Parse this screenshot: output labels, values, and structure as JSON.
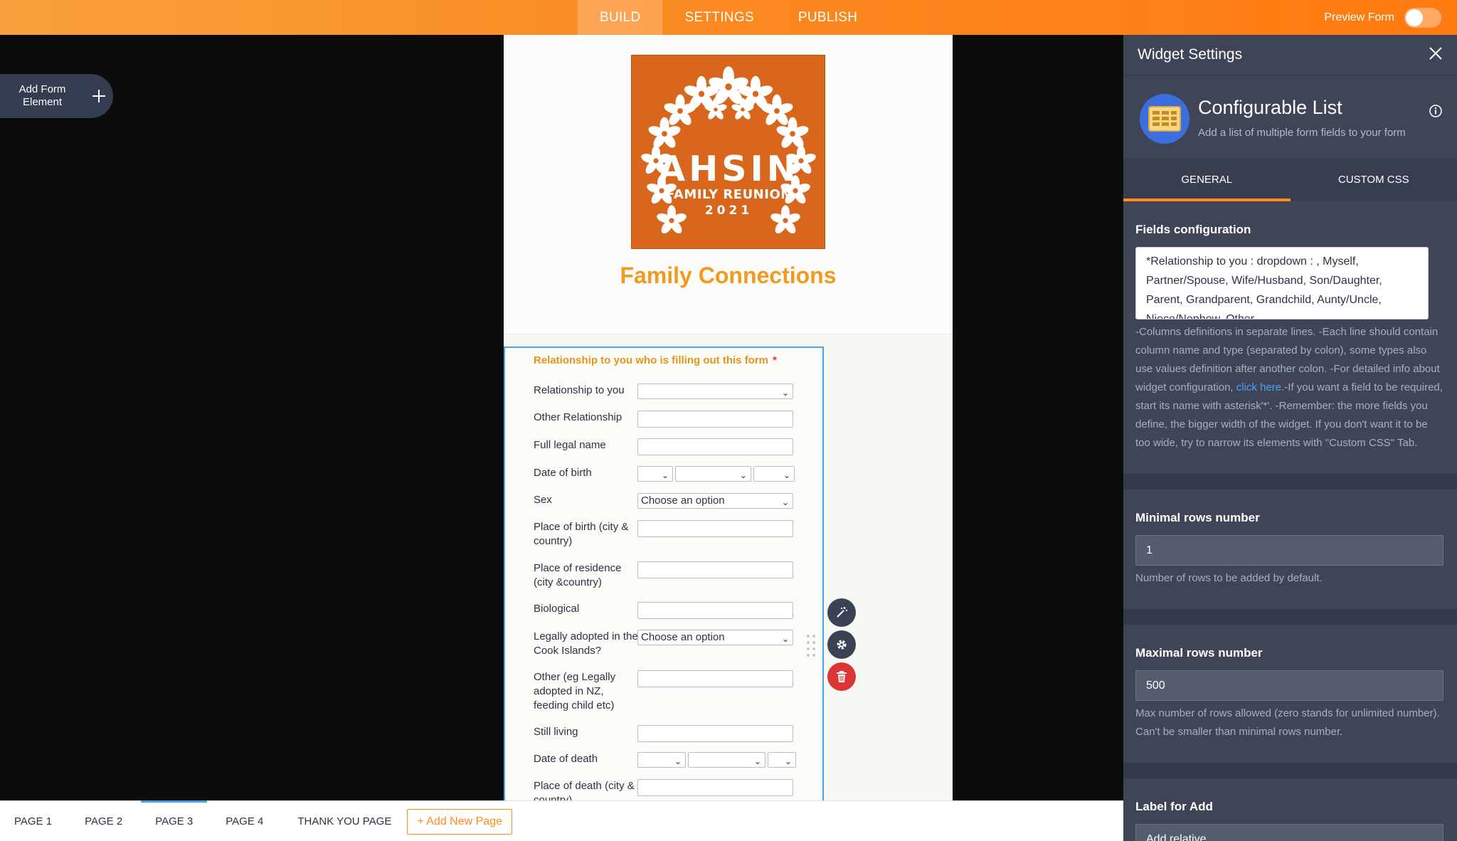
{
  "topbar": {
    "tabs": [
      {
        "label": "BUILD",
        "active": true
      },
      {
        "label": "SETTINGS",
        "active": false
      },
      {
        "label": "PUBLISH",
        "active": false
      }
    ],
    "preview_label": "Preview Form",
    "preview_on": false
  },
  "sidebar": {
    "add_element_label": "Add Form Element"
  },
  "form": {
    "logo": {
      "line1": "AHSIN",
      "line2": "FAMILY REUNION",
      "line3": "2021"
    },
    "title": "Family Connections",
    "widget": {
      "label": "Relationship to you who is filling out this form",
      "required_mark": "*",
      "rows": [
        {
          "label": "Relationship to you",
          "type": "select",
          "value": ""
        },
        {
          "label": "Other Relationship",
          "type": "text"
        },
        {
          "label": "Full legal name",
          "type": "text"
        },
        {
          "label": "Date of birth",
          "type": "date"
        },
        {
          "label": "Sex",
          "type": "select",
          "value": "Choose an option"
        },
        {
          "label": "Place of birth (city & country)",
          "type": "text"
        },
        {
          "label": "Place of residence (city &country)",
          "type": "text"
        },
        {
          "label": "Biological",
          "type": "text"
        },
        {
          "label": "Legally adopted in the Cook Islands?",
          "type": "select",
          "value": "Choose an option"
        },
        {
          "label": "Other (eg Legally adopted in NZ, feeding child etc)",
          "type": "text"
        },
        {
          "label": "Still living",
          "type": "text"
        },
        {
          "label": "Date of death",
          "type": "date"
        },
        {
          "label": "Place of death (city & country)",
          "type": "text"
        }
      ]
    },
    "actions": [
      "wand-icon",
      "gear-icon",
      "trash-icon"
    ]
  },
  "pages": {
    "tabs": [
      {
        "label": "PAGE 1",
        "active": false
      },
      {
        "label": "PAGE 2",
        "active": false
      },
      {
        "label": "PAGE 3",
        "active": true
      },
      {
        "label": "PAGE 4",
        "active": false
      },
      {
        "label": "THANK YOU PAGE",
        "active": false
      }
    ],
    "add_label": "+ Add New Page"
  },
  "panel": {
    "title": "Widget Settings",
    "widget_name": "Configurable List",
    "widget_desc": "Add a list of multiple form fields to your form",
    "tabs": [
      {
        "label": "GENERAL",
        "active": true
      },
      {
        "label": "CUSTOM CSS",
        "active": false
      }
    ],
    "fields_config": {
      "title": "Fields configuration",
      "value": "*Relationship to you : dropdown : , Myself, Partner/Spouse, Wife/Husband, Son/Daughter, Parent, Grandparent, Grandchild, Aunty/Uncle, Niece/Nephew, Other",
      "help_before_link": "-Columns definitions in separate lines. -Each line should contain column name and type (separated by colon), some types also use values definition after another colon. -For detailed info about widget configuration, ",
      "link_text": "click here",
      "help_after_link": ".-If you want a field to be required, start its name with asterisk'*'. -Remember: the more fields you define, the bigger width of the widget. If you don't want it to be too wide, try to narrow its elements with \"Custom CSS\" Tab."
    },
    "min_rows": {
      "title": "Minimal rows number",
      "value": "1",
      "help": "Number of rows to be added by default."
    },
    "max_rows": {
      "title": "Maximal rows number",
      "value": "500",
      "help": "Max number of rows allowed (zero stands for unlimited number). Can't be smaller than minimal rows number."
    },
    "add_label": {
      "title": "Label for Add",
      "value": "Add relative"
    }
  },
  "colors": {
    "accent": "#ff8b1a",
    "selection": "#4aa3df",
    "panel": "#3f4557",
    "delete": "#dd3535"
  }
}
